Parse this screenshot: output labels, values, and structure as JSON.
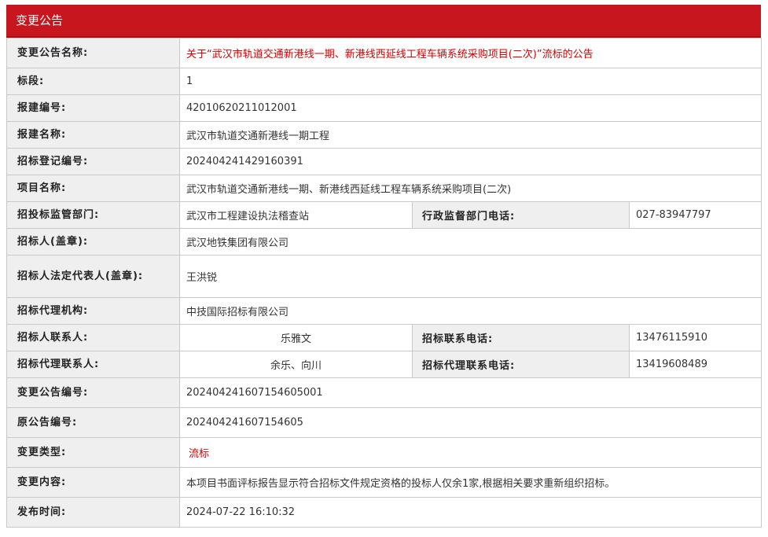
{
  "header": {
    "title": "变更公告"
  },
  "rows": {
    "notice_name": {
      "label": "变更公告名称:",
      "value": "关于“武汉市轨道交通新港线一期、新港线西延线工程车辆系统采购项目(二次)”流标的公告"
    },
    "section": {
      "label": "标段:",
      "value": "1"
    },
    "build_no": {
      "label": "报建编号:",
      "value": "42010620211012001"
    },
    "build_name": {
      "label": "报建名称:",
      "value": "武汉市轨道交通新港线一期工程"
    },
    "reg_no": {
      "label": "招标登记编号:",
      "value": "202404241429160391"
    },
    "project_name": {
      "label": "项目名称:",
      "value": "武汉市轨道交通新港线一期、新港线西延线工程车辆系统采购项目(二次)"
    },
    "supervisor": {
      "label": "招投标监管部门:",
      "value": "武汉市工程建设执法稽查站",
      "phone_label": "行政监督部门电话:",
      "phone": "027-83947797"
    },
    "tenderer": {
      "label": "招标人(盖章):",
      "value": "武汉地铁集团有限公司"
    },
    "legal_rep": {
      "label": "招标人法定代表人(盖章):",
      "value": "王洪锐"
    },
    "agency": {
      "label": "招标代理机构:",
      "value": "中技国际招标有限公司"
    },
    "contact": {
      "label": "招标人联系人:",
      "value": "乐雅文",
      "phone_label": "招标联系电话:",
      "phone": "13476115910"
    },
    "agency_contact": {
      "label": "招标代理联系人:",
      "value": "余乐、向川",
      "phone_label": "招标代理联系电话:",
      "phone": "13419608489"
    },
    "change_no": {
      "label": "变更公告编号:",
      "value": "202404241607154605001"
    },
    "orig_no": {
      "label": "原公告编号:",
      "value": "202404241607154605"
    },
    "change_type": {
      "label": "变更类型:",
      "value": "流标"
    },
    "change_content": {
      "label": "变更内容:",
      "value": "本项目书面评标报告显示符合招标文件规定资格的投标人仅余1家,根据相关要求重新组织招标。"
    },
    "publish_time": {
      "label": "发布时间:",
      "value": "2024-07-22 16:10:32"
    }
  }
}
